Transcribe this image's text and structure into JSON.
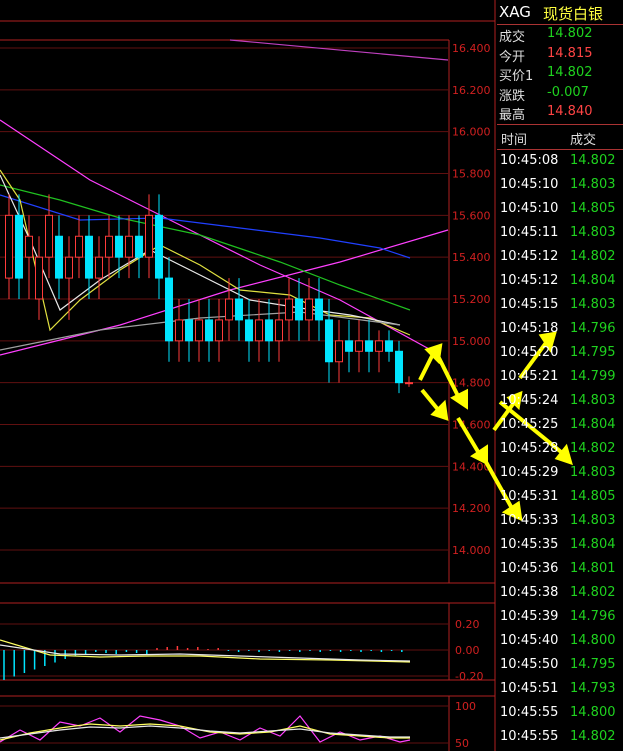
{
  "instrument": {
    "code": "XAG",
    "name": "现货白银"
  },
  "quote": [
    {
      "label": "成交",
      "value": "14.802",
      "color": "#1fd21f"
    },
    {
      "label": "今开",
      "value": "14.815",
      "color": "#ff4444"
    },
    {
      "label": "买价1",
      "value": "14.802",
      "color": "#1fd21f"
    },
    {
      "label": "涨跌",
      "value": "-0.007",
      "color": "#1fd21f"
    },
    {
      "label": "最高",
      "value": "14.840",
      "color": "#ff4444"
    }
  ],
  "ticks_header": {
    "time": "时间",
    "price": "成交"
  },
  "ticks": [
    {
      "time": "10:45:08",
      "price": "14.802"
    },
    {
      "time": "10:45:10",
      "price": "14.803"
    },
    {
      "time": "10:45:10",
      "price": "14.805"
    },
    {
      "time": "10:45:11",
      "price": "14.803"
    },
    {
      "time": "10:45:12",
      "price": "14.802"
    },
    {
      "time": "10:45:12",
      "price": "14.804"
    },
    {
      "time": "10:45:15",
      "price": "14.803"
    },
    {
      "time": "10:45:18",
      "price": "14.796"
    },
    {
      "time": "10:45:20",
      "price": "14.795"
    },
    {
      "time": "10:45:21",
      "price": "14.799"
    },
    {
      "time": "10:45:24",
      "price": "14.803"
    },
    {
      "time": "10:45:25",
      "price": "14.804"
    },
    {
      "time": "10:45:28",
      "price": "14.802"
    },
    {
      "time": "10:45:29",
      "price": "14.803"
    },
    {
      "time": "10:45:31",
      "price": "14.805"
    },
    {
      "time": "10:45:33",
      "price": "14.803"
    },
    {
      "time": "10:45:35",
      "price": "14.804"
    },
    {
      "time": "10:45:36",
      "price": "14.801"
    },
    {
      "time": "10:45:38",
      "price": "14.802"
    },
    {
      "time": "10:45:39",
      "price": "14.796"
    },
    {
      "time": "10:45:40",
      "price": "14.800"
    },
    {
      "time": "10:45:50",
      "price": "14.795"
    },
    {
      "time": "10:45:51",
      "price": "14.793"
    },
    {
      "time": "10:45:55",
      "price": "14.800"
    },
    {
      "time": "10:45:55",
      "price": "14.802"
    }
  ],
  "colors": {
    "up": "#ff3b3b",
    "down": "#00e5ff",
    "grid": "#b02020",
    "axis_text": "#d02020",
    "arrow": "#ffff00"
  },
  "chart_data": {
    "type": "candlestick",
    "ylim": [
      13.8,
      16.5
    ],
    "y_ticks": [
      "16.400",
      "16.200",
      "16.000",
      "15.800",
      "15.600",
      "15.400",
      "15.200",
      "15.000",
      "14.800",
      "14.600",
      "14.400",
      "14.200",
      "14.000"
    ],
    "y_tick_values": [
      16.4,
      16.2,
      16.0,
      15.8,
      15.6,
      15.4,
      15.2,
      15.0,
      14.8,
      14.6,
      14.4,
      14.2,
      14.0
    ],
    "candles": [
      [
        15.3,
        15.6,
        15.2,
        15.7
      ],
      [
        15.6,
        15.3,
        15.2,
        15.7
      ],
      [
        15.4,
        15.5,
        15.2,
        15.6
      ],
      [
        15.2,
        15.4,
        15.1,
        15.5
      ],
      [
        15.4,
        15.6,
        15.3,
        15.7
      ],
      [
        15.5,
        15.3,
        15.2,
        15.6
      ],
      [
        15.3,
        15.4,
        15.1,
        15.5
      ],
      [
        15.4,
        15.5,
        15.3,
        15.6
      ],
      [
        15.5,
        15.3,
        15.2,
        15.6
      ],
      [
        15.3,
        15.4,
        15.2,
        15.5
      ],
      [
        15.4,
        15.5,
        15.3,
        15.6
      ],
      [
        15.5,
        15.4,
        15.3,
        15.6
      ],
      [
        15.4,
        15.5,
        15.3,
        15.6
      ],
      [
        15.5,
        15.4,
        15.3,
        15.6
      ],
      [
        15.4,
        15.6,
        15.3,
        15.7
      ],
      [
        15.6,
        15.3,
        15.2,
        15.7
      ],
      [
        15.3,
        15.0,
        14.9,
        15.4
      ],
      [
        15.0,
        15.1,
        14.9,
        15.2
      ],
      [
        15.1,
        15.0,
        14.9,
        15.2
      ],
      [
        15.0,
        15.1,
        14.9,
        15.2
      ],
      [
        15.1,
        15.0,
        14.9,
        15.2
      ],
      [
        15.0,
        15.1,
        14.9,
        15.2
      ],
      [
        15.1,
        15.2,
        15.0,
        15.3
      ],
      [
        15.2,
        15.1,
        15.0,
        15.3
      ],
      [
        15.1,
        15.0,
        14.9,
        15.2
      ],
      [
        15.0,
        15.1,
        14.9,
        15.2
      ],
      [
        15.1,
        15.0,
        14.9,
        15.2
      ],
      [
        15.0,
        15.1,
        14.9,
        15.2
      ],
      [
        15.1,
        15.2,
        15.0,
        15.3
      ],
      [
        15.2,
        15.1,
        15.0,
        15.3
      ],
      [
        15.1,
        15.2,
        15.0,
        15.3
      ],
      [
        15.2,
        15.1,
        15.0,
        15.3
      ],
      [
        15.1,
        14.9,
        14.8,
        15.2
      ],
      [
        14.9,
        15.0,
        14.8,
        15.1
      ],
      [
        15.0,
        14.95,
        14.85,
        15.1
      ],
      [
        14.95,
        15.0,
        14.85,
        15.1
      ],
      [
        15.0,
        14.95,
        14.85,
        15.1
      ],
      [
        14.95,
        15.0,
        14.85,
        15.05
      ],
      [
        15.0,
        14.95,
        14.9,
        15.05
      ],
      [
        14.95,
        14.8,
        14.75,
        15.0
      ],
      [
        14.8,
        14.8,
        14.78,
        14.83
      ]
    ],
    "mid_ticks": [
      "0.20",
      "0.00",
      "-0.20"
    ],
    "bottom_ticks": [
      "100",
      "50"
    ]
  }
}
